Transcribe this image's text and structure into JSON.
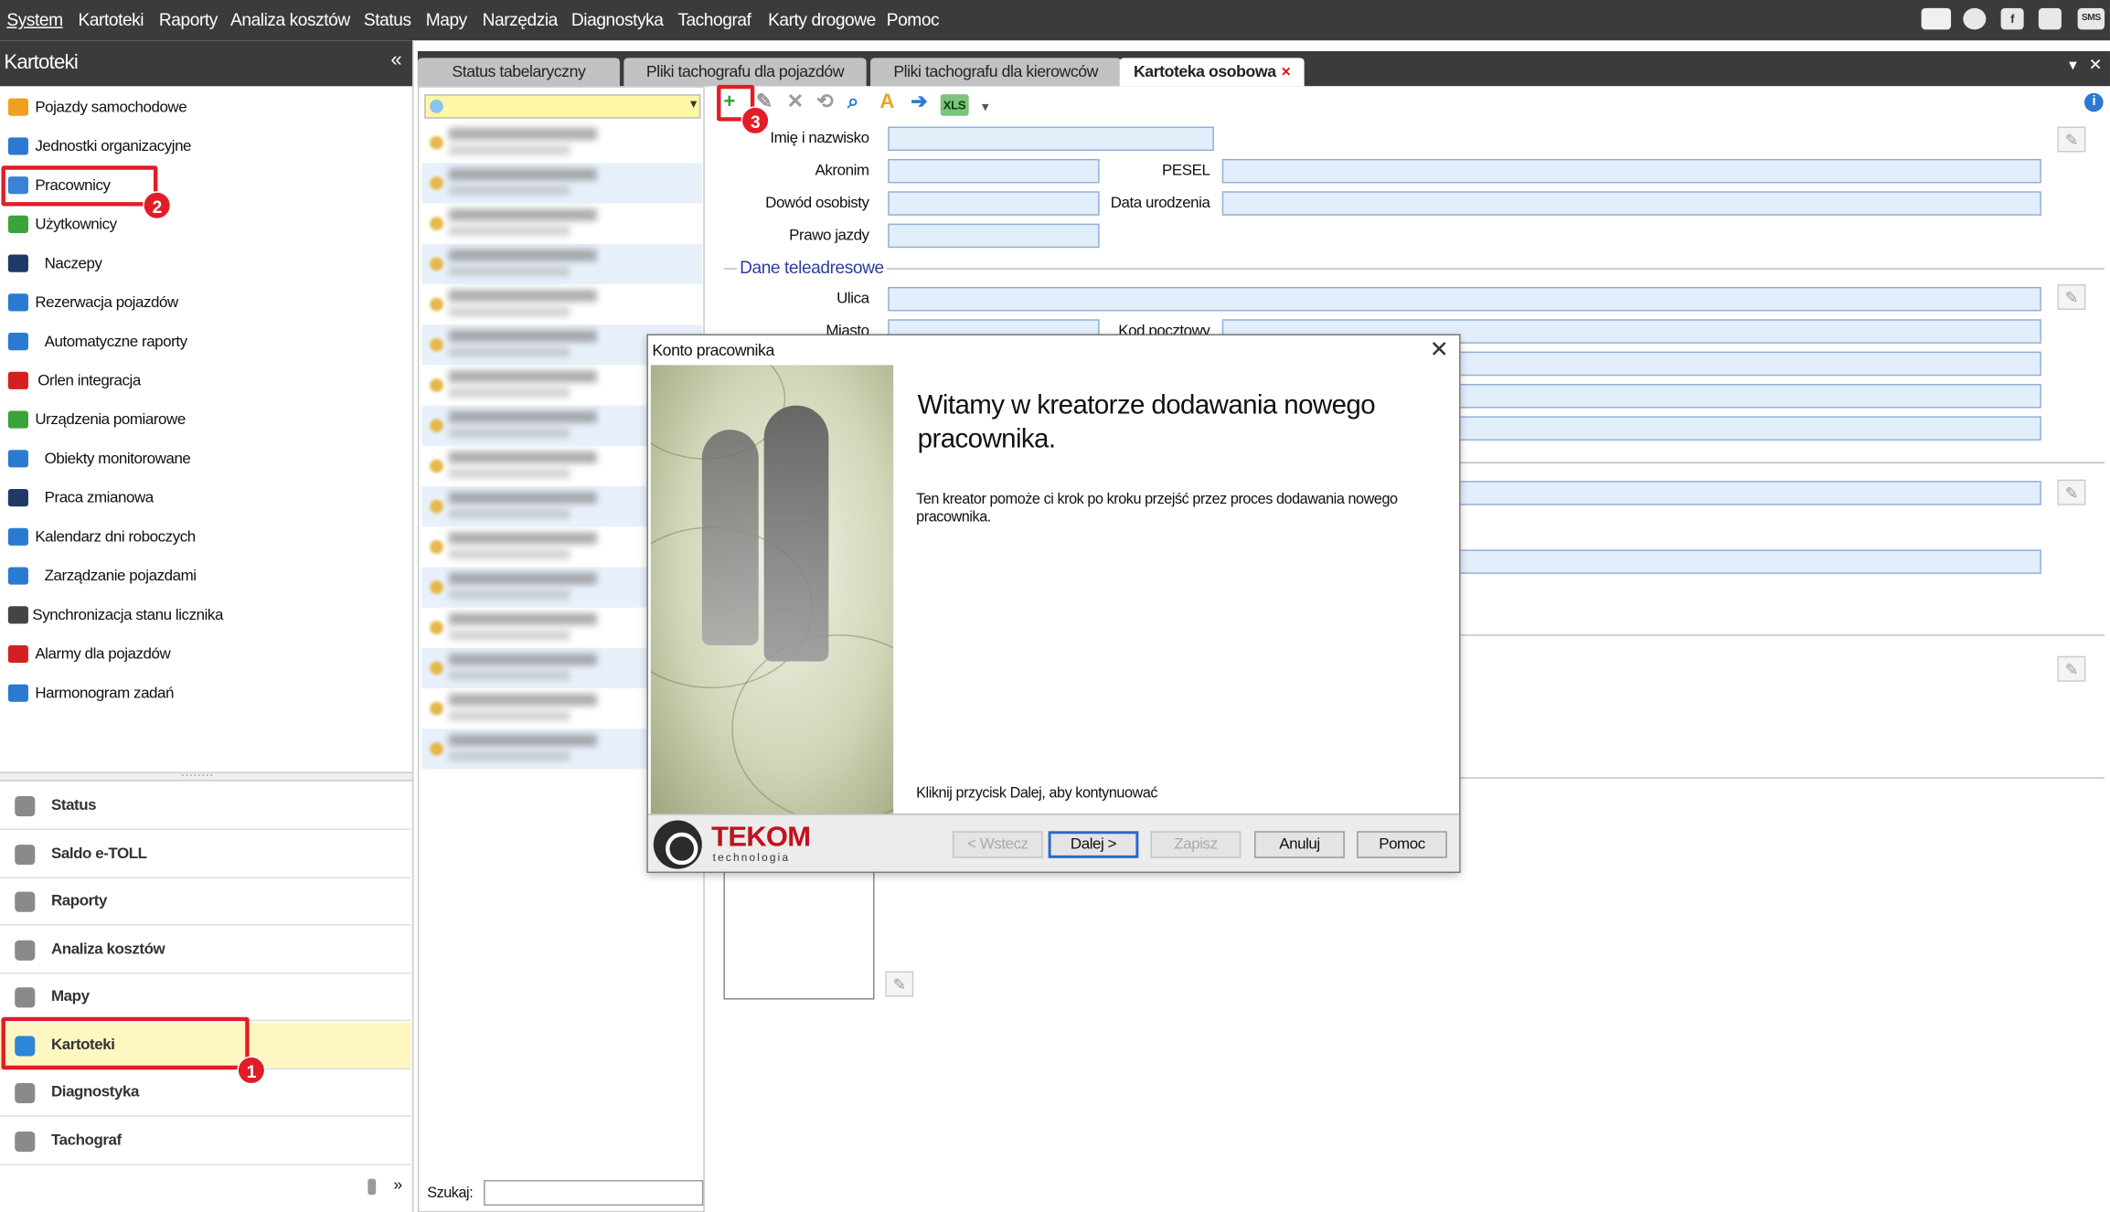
{
  "menu": [
    "System",
    "Kartoteki",
    "Raporty",
    "Analiza kosztów",
    "Status",
    "Mapy",
    "Narzędzia",
    "Diagnostyka",
    "Tachograf",
    "Karty drogowe",
    "Pomoc"
  ],
  "top_icons": [
    {
      "icon": "mail-icon",
      "text": ""
    },
    {
      "icon": "teamviewer-icon",
      "text": ""
    },
    {
      "icon": "facebook-icon",
      "text": "f"
    },
    {
      "icon": "phone-icon",
      "text": ""
    },
    {
      "icon": "sms-icon",
      "text": "SMS"
    }
  ],
  "left": {
    "title": "Kartoteki",
    "collapse_glyph": "«",
    "items": [
      {
        "label": "Pojazdy samochodowe",
        "icon": "car-icon",
        "color": "#f0a020"
      },
      {
        "label": "Jednostki organizacyjne",
        "icon": "home-icon",
        "color": "#2b7ad1"
      },
      {
        "label": "Pracownicy",
        "icon": "person-icon",
        "color": "#3b82d6"
      },
      {
        "label": "Użytkownicy",
        "icon": "users-icon",
        "color": "#3aa33a"
      },
      {
        "label": "Naczepy",
        "icon": "trailer-icon",
        "color": "#1f3a66"
      },
      {
        "label": "Rezerwacja pojazdów",
        "icon": "calendar-icon",
        "color": "#2b7ad1"
      },
      {
        "label": "Automatyczne raporty",
        "icon": "auto-report-icon",
        "color": "#2b7ad1"
      },
      {
        "label": "Orlen integracja",
        "icon": "orlen-icon",
        "color": "#d42020"
      },
      {
        "label": "Urządzenia pomiarowe",
        "icon": "sensor-icon",
        "color": "#3aa33a"
      },
      {
        "label": "Obiekty monitorowane",
        "icon": "truck-icon",
        "color": "#2b7ad1"
      },
      {
        "label": "Praca zmianowa",
        "icon": "shift-icon",
        "color": "#1f3a66"
      },
      {
        "label": "Kalendarz dni roboczych",
        "icon": "workday-calendar-icon",
        "color": "#2b7ad1"
      },
      {
        "label": "Zarządzanie pojazdami",
        "icon": "fleet-icon",
        "color": "#2b7ad1"
      },
      {
        "label": "Synchronizacja stanu licznika",
        "icon": "odometer-icon",
        "color": "#444444"
      },
      {
        "label": "Alarmy dla pojazdów",
        "icon": "alarm-icon",
        "color": "#d42020"
      },
      {
        "label": "Harmonogram zadań",
        "icon": "schedule-icon",
        "color": "#2b7ad1"
      }
    ],
    "bottom": [
      {
        "label": "Status",
        "icon": "location-pin-icon",
        "active": false
      },
      {
        "label": "Saldo e-TOLL",
        "icon": "etoll-icon",
        "active": false
      },
      {
        "label": "Raporty",
        "icon": "bar-chart-icon",
        "active": false
      },
      {
        "label": "Analiza kosztów",
        "icon": "coins-icon",
        "active": false
      },
      {
        "label": "Mapy",
        "icon": "globe-icon",
        "active": false
      },
      {
        "label": "Kartoteki",
        "icon": "folder-icon",
        "active": true
      },
      {
        "label": "Diagnostyka",
        "icon": "wrench-icon",
        "active": false
      },
      {
        "label": "Tachograf",
        "icon": "tachograph-icon",
        "active": false
      }
    ],
    "footer_glyph": "»"
  },
  "tabs": [
    {
      "label": "Status tabelaryczny",
      "active": false
    },
    {
      "label": "Pliki tachografu dla pojazdów",
      "active": false
    },
    {
      "label": "Pliki tachografu dla kierowców",
      "active": false
    },
    {
      "label": "Kartoteka osobowa",
      "active": true
    }
  ],
  "tab_close_glyph": "×",
  "list": {
    "search_label": "Szukaj:",
    "search_value": "",
    "row_count": 16
  },
  "toolbar": {
    "buttons": [
      {
        "icon": "add-icon",
        "glyph": "+",
        "color": "#2f9e2f"
      },
      {
        "icon": "edit-icon",
        "glyph": "✎",
        "color": "#9a9a9a"
      },
      {
        "icon": "delete-icon",
        "glyph": "✕",
        "color": "#9a9a9a"
      },
      {
        "icon": "restore-icon",
        "glyph": "⟲",
        "color": "#9a9a9a"
      },
      {
        "icon": "search-icon",
        "glyph": "⌕",
        "color": "#2b7ad1"
      },
      {
        "icon": "filter-a-icon",
        "glyph": "A",
        "color": "#e6a817"
      },
      {
        "icon": "export-icon",
        "glyph": "➔",
        "color": "#2b7ad1"
      },
      {
        "icon": "xls-icon",
        "glyph": "XLS",
        "color": "#2f9e2f"
      }
    ],
    "info_glyph": "i"
  },
  "form": {
    "labels": {
      "name": "Imię i nazwisko",
      "akronim": "Akronim",
      "pesel": "PESEL",
      "dowod": "Dowód osobisty",
      "data_ur": "Data urodzenia",
      "prawo": "Prawo jazdy",
      "section": "Dane teleadresowe",
      "ulica": "Ulica",
      "miasto": "Miasto",
      "kod": "Kod pocztowy"
    },
    "edit_glyph": "✎"
  },
  "modal": {
    "title": "Konto pracownika",
    "close_glyph": "✕",
    "heading": "Witamy w kreatorze dodawania nowego pracownika.",
    "body": "Ten kreator pomoże ci krok po kroku przejść przez proces dodawania nowego pracownika.",
    "continue": "Kliknij przycisk Dalej, aby kontynuować",
    "logo_name": "TEKOM",
    "logo_sub": "technologia",
    "buttons": {
      "back": "< Wstecz",
      "next": "Dalej >",
      "save": "Zapisz",
      "cancel": "Anuluj",
      "help": "Pomoc"
    }
  },
  "markers": [
    "1",
    "2",
    "3"
  ],
  "accent": "#e11d27"
}
